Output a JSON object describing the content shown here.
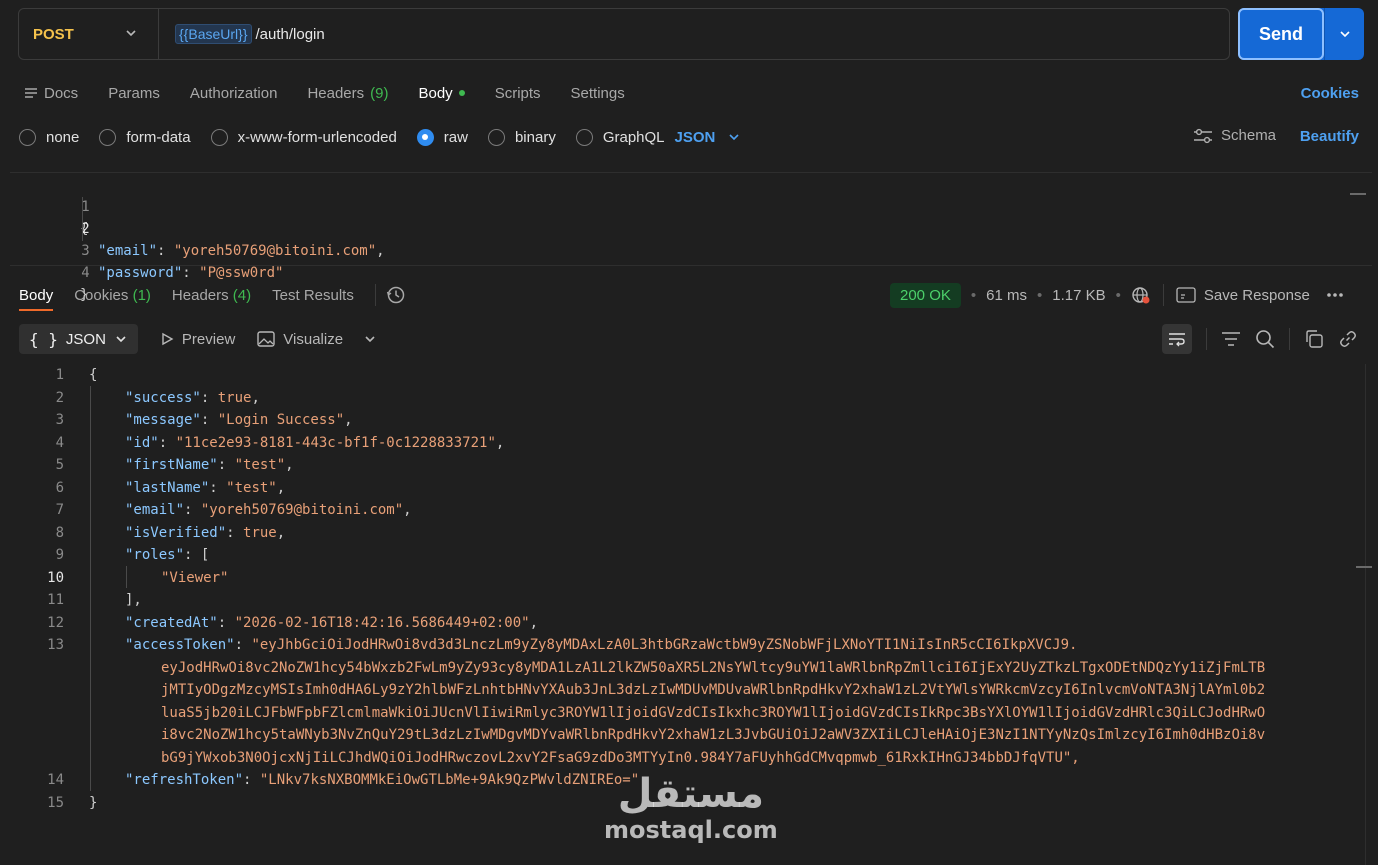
{
  "request": {
    "method": "POST",
    "url_var": "{{BaseUrl}}",
    "url_path": "/auth/login",
    "send_label": "Send"
  },
  "request_tabs": {
    "docs": "Docs",
    "params": "Params",
    "authorization": "Authorization",
    "headers": "Headers",
    "headers_count": "(9)",
    "body": "Body",
    "scripts": "Scripts",
    "settings": "Settings",
    "cookies": "Cookies"
  },
  "body_types": {
    "none": "none",
    "form_data": "form-data",
    "urlencoded": "x-www-form-urlencoded",
    "raw": "raw",
    "binary": "binary",
    "graphql": "GraphQL",
    "format": "JSON",
    "schema": "Schema",
    "beautify": "Beautify"
  },
  "request_body": {
    "line_numbers": [
      "1",
      "2",
      "3",
      "4"
    ],
    "open": "{",
    "email_key": "\"email\"",
    "email_val": "\"yoreh50769@bitoini.com\"",
    "password_key": "\"password\"",
    "password_val": "\"P@ssw0rd\"",
    "close": "}"
  },
  "response_tabs": {
    "body": "Body",
    "cookies": "Cookies",
    "cookies_count": "(1)",
    "headers": "Headers",
    "headers_count": "(4)",
    "test_results": "Test Results"
  },
  "response_meta": {
    "status": "200 OK",
    "time": "61 ms",
    "size": "1.17 KB",
    "save_response": "Save Response"
  },
  "response_toolbar": {
    "format": "JSON",
    "preview": "Preview",
    "visualize": "Visualize"
  },
  "response_body": {
    "l1": "{",
    "success_key": "\"success\"",
    "success_val": "true",
    "message_key": "\"message\"",
    "message_val": "\"Login Success\"",
    "id_key": "\"id\"",
    "id_val": "\"11ce2e93-8181-443c-bf1f-0c1228833721\"",
    "firstName_key": "\"firstName\"",
    "firstName_val": "\"test\"",
    "lastName_key": "\"lastName\"",
    "lastName_val": "\"test\"",
    "email_key": "\"email\"",
    "email_val": "\"yoreh50769@bitoini.com\"",
    "isVerified_key": "\"isVerified\"",
    "isVerified_val": "true",
    "roles_key": "\"roles\"",
    "roles_open": "[",
    "roles_item": "\"Viewer\"",
    "roles_close": "],",
    "createdAt_key": "\"createdAt\"",
    "createdAt_val": "\"2026-02-16T18:42:16.5686449+02:00\"",
    "accessToken_key": "\"accessToken\"",
    "accessToken_lines": [
      "\"eyJhbGciOiJodHRwOi8vd3d3LnczLm9yZy8yMDAxLzA0L3htbGRzaWctbW9yZSNobWFjLXNoYTI1NiIsInR5cCI6IkpXVCJ9.",
      "eyJodHRwOi8vc2NoZW1hcy54bWxzb2FwLm9yZy93cy8yMDA1LzA1L2lkZW50aXR5L2NsYWltcy9uYW1laWRlbnRpZmllciI6IjExY2UyZTkzLTgxODEtNDQzYy1iZjFmLTB",
      "jMTIyODgzMzcyMSIsImh0dHA6Ly9zY2hlbWFzLnhtbHNvYXAub3JnL3dzLzIwMDUvMDUvaWRlbnRpdHkvY2xhaW1zL2VtYWlsYWRkcmVzcyI6InlvcmVoNTA3NjlAYml0b2",
      "luaS5jb20iLCJFbWFpbFZlcmlmaWkiOiJUcnVlIiwiRmlyc3ROYW1lIjoidGVzdCIsIkxhc3ROYW1lIjoidGVzdCIsIkRpc3BsYXlOYW1lIjoidGVzdHRlc3QiLCJodHRwO",
      "i8vc2NoZW1hcy5taWNyb3NvZnQuY29tL3dzLzIwMDgvMDYvaWRlbnRpdHkvY2xhaW1zL3JvbGUiOiJ2aWV3ZXIiLCJleHAiOjE3NzI1NTYyNzQsImlzcyI6Imh0dHBzOi8v",
      "bG9jYWxob3N0OjcxNjIiLCJhdWQiOiJodHRwczovL2xvY2FsaG9zdDo3MTYyIn0.984Y7aFUyhhGdCMvqpmwb_61RxkIHnGJ34bbDJfqVTU\","
    ],
    "refreshToken_key": "\"refreshToken\"",
    "refreshToken_val": "\"LNkv7ksNXBOMMkEiOwGTLbMe+9Ak9QzPWvldZNIREo=\"",
    "l15": "}"
  },
  "watermark": {
    "arabic": "مستقل",
    "latin": "mostaql.com"
  }
}
